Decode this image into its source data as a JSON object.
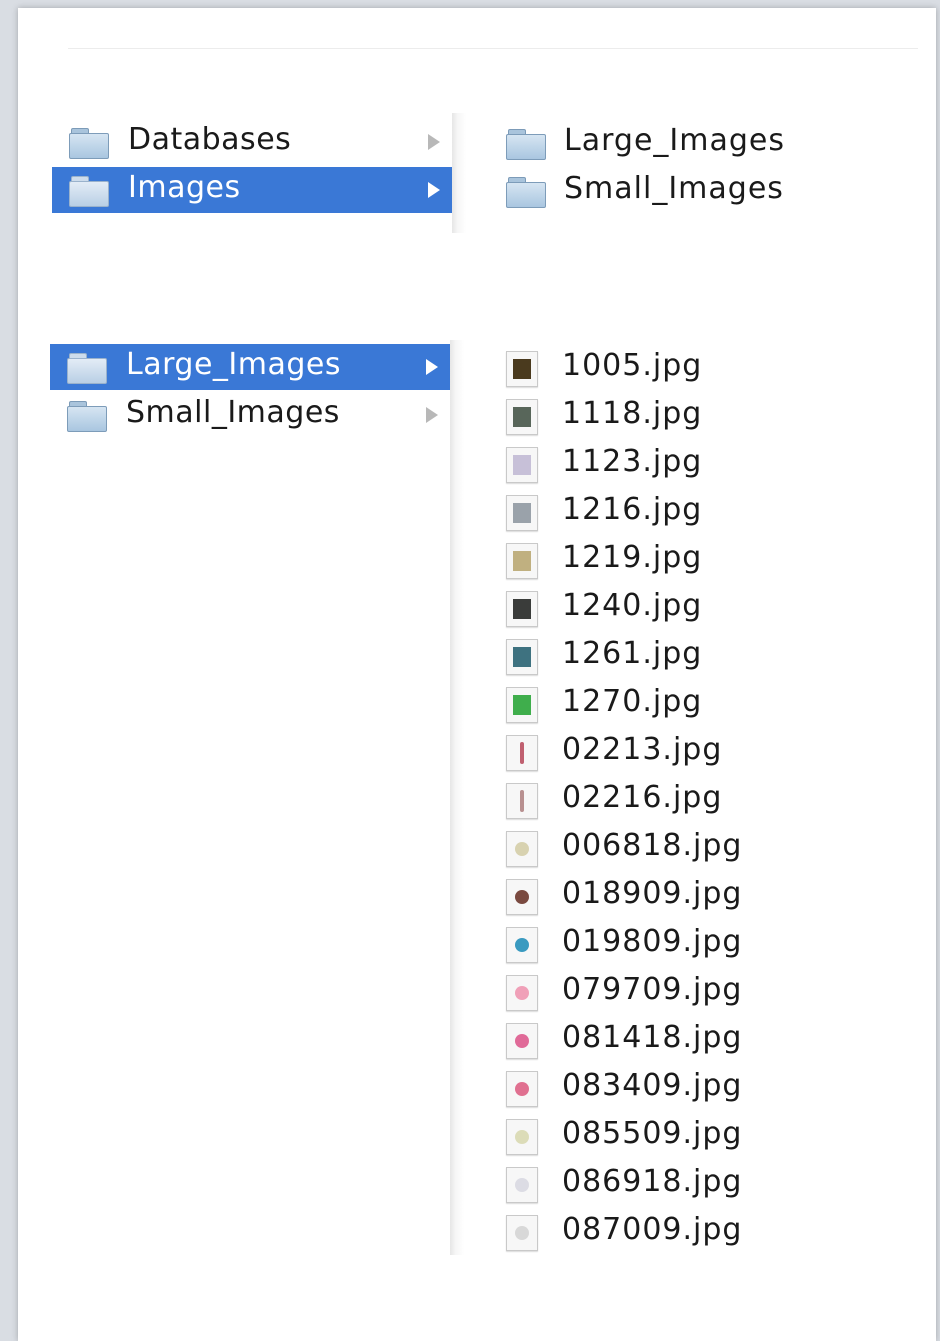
{
  "browser_top": {
    "column1": [
      {
        "label": "Databases",
        "selected": false
      },
      {
        "label": "Images",
        "selected": true
      }
    ],
    "column2": [
      {
        "label": "Large_Images"
      },
      {
        "label": "Small_Images"
      }
    ]
  },
  "browser_bottom": {
    "column1": [
      {
        "label": "Large_Images",
        "selected": true
      },
      {
        "label": "Small_Images",
        "selected": false
      }
    ],
    "files": [
      {
        "name": "1005.jpg",
        "thumb": "dark-photo-icon",
        "color": "#4a3a1e",
        "kind": "photo"
      },
      {
        "name": "1118.jpg",
        "thumb": "landscape-photo-icon",
        "color": "#58665a",
        "kind": "photo"
      },
      {
        "name": "1123.jpg",
        "thumb": "pale-photo-icon",
        "color": "#c7c0d8",
        "kind": "photo"
      },
      {
        "name": "1216.jpg",
        "thumb": "sky-photo-icon",
        "color": "#9aa2aa",
        "kind": "photo"
      },
      {
        "name": "1219.jpg",
        "thumb": "building-photo-icon",
        "color": "#c0b080",
        "kind": "photo"
      },
      {
        "name": "1240.jpg",
        "thumb": "dark-photo-icon",
        "color": "#3a3c3a",
        "kind": "photo"
      },
      {
        "name": "1261.jpg",
        "thumb": "harbor-photo-icon",
        "color": "#3e7280",
        "kind": "photo"
      },
      {
        "name": "1270.jpg",
        "thumb": "green-photo-icon",
        "color": "#3fae4c",
        "kind": "photo"
      },
      {
        "name": "02213.jpg",
        "thumb": "glass-object-icon",
        "color": "#c06070",
        "kind": "stick"
      },
      {
        "name": "02216.jpg",
        "thumb": "glass-object-icon",
        "color": "#b89090",
        "kind": "stick"
      },
      {
        "name": "006818.jpg",
        "thumb": "round-object-icon",
        "color": "#d8d2b0",
        "kind": "dot"
      },
      {
        "name": "018909.jpg",
        "thumb": "round-object-icon",
        "color": "#7a4a40",
        "kind": "dot"
      },
      {
        "name": "019809.jpg",
        "thumb": "round-object-icon",
        "color": "#3a9ac0",
        "kind": "dot"
      },
      {
        "name": "079709.jpg",
        "thumb": "heart-object-icon",
        "color": "#f0a0b8",
        "kind": "dot"
      },
      {
        "name": "081418.jpg",
        "thumb": "heart-object-icon",
        "color": "#e06a98",
        "kind": "dot"
      },
      {
        "name": "083409.jpg",
        "thumb": "round-object-icon",
        "color": "#e07090",
        "kind": "dot"
      },
      {
        "name": "085509.jpg",
        "thumb": "round-object-icon",
        "color": "#dcdcb8",
        "kind": "dot"
      },
      {
        "name": "086918.jpg",
        "thumb": "round-object-icon",
        "color": "#dcdce4",
        "kind": "dot"
      },
      {
        "name": "087009.jpg",
        "thumb": "round-object-icon",
        "color": "#d8d8d8",
        "kind": "dot"
      }
    ]
  }
}
